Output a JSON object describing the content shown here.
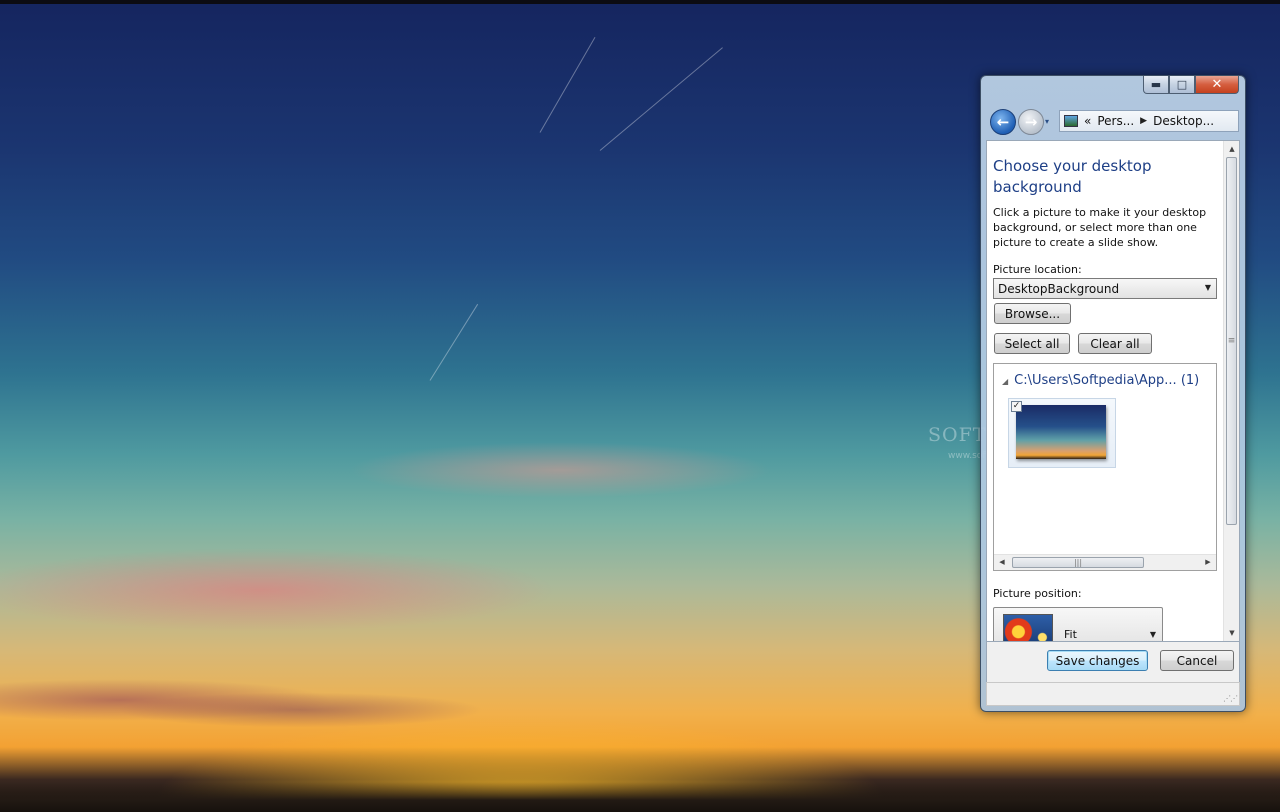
{
  "watermark": {
    "brand": "SOFTPEDIA",
    "url": "www.softpedia.com"
  },
  "window": {
    "caption_buttons": {
      "minimize": "▬",
      "maximize": "□",
      "close": "✕"
    },
    "nav": {
      "back_icon": "back-arrow-icon",
      "forward_icon": "forward-arrow-icon",
      "dropdown": "▾"
    },
    "address": {
      "overflow": "«",
      "segments": [
        "Pers...",
        "Desktop..."
      ],
      "separator": "▶"
    },
    "heading": "Choose your desktop background",
    "description": "Click a picture to make it your desktop background, or select more than one picture to create a slide show.",
    "picture_location_label": "Picture location:",
    "picture_location_value": "DesktopBackground",
    "browse_label": "Browse...",
    "select_all_label": "Select all",
    "clear_all_label": "Clear all",
    "picture_group": {
      "title": "C:\\Users\\Softpedia\\App... (1)",
      "checked": true
    },
    "picture_position_label": "Picture position:",
    "picture_position_value": "Fit",
    "save_label": "Save changes",
    "cancel_label": "Cancel"
  },
  "colors": {
    "heading_blue": "#1e3f86",
    "close_red": "#c4411e",
    "default_button": "#3c7fb1"
  }
}
